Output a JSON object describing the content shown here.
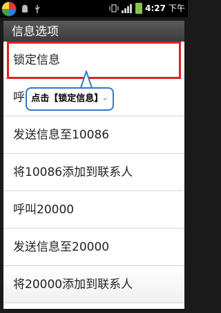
{
  "status_bar": {
    "time": "4:27",
    "period": "下午",
    "icons": [
      "app-icon",
      "android-icon",
      "usb-icon",
      "vibrate-icon",
      "signal-icon",
      "battery-icon"
    ]
  },
  "dialog": {
    "title": "信息选项",
    "items": [
      {
        "label": "锁定信息"
      },
      {
        "label": "呼叫10086"
      },
      {
        "label": "发送信息至10086"
      },
      {
        "label": "将10086添加到联系人"
      },
      {
        "label": "呼叫20000"
      },
      {
        "label": "发送信息至20000"
      },
      {
        "label": "将20000添加到联系人"
      }
    ]
  },
  "annotation": {
    "text": "点击【锁定信息】",
    "mark": "↵",
    "highlight_color": "#e02020",
    "callout_border_color": "#2f78c7"
  }
}
